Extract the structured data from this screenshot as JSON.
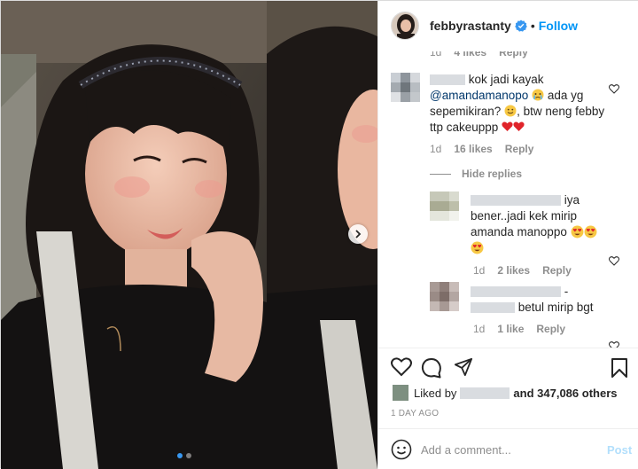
{
  "header": {
    "username": "febbyrastanty",
    "separator": "•",
    "follow_label": "Follow"
  },
  "comments": {
    "partial_meta": {
      "time": "1d",
      "likes": "4 likes",
      "reply": "Reply"
    },
    "main": {
      "text_line1": "kok jadi kayak",
      "mention": "@amandamanopo",
      "text_line2_suffix": "ada yg",
      "text_line3": "sepemikiran?",
      "text_line3_suffix": ", btw neng febby",
      "text_line4": "ttp cakeuppp",
      "time": "1d",
      "likes": "16 likes",
      "reply": "Reply"
    },
    "hide_replies": "Hide replies",
    "reply1": {
      "text_line1": "iya",
      "text_line2": "bener..jadi kek mirip",
      "text_line3": "amanda manoppo",
      "time": "1d",
      "likes": "2 likes",
      "reply": "Reply"
    },
    "reply2": {
      "text_line1": "-",
      "text_line2": "betul mirip bgt",
      "time": "1d",
      "likes": "1 like",
      "reply": "Reply"
    }
  },
  "likes_bar": {
    "prefix": "Liked by",
    "and_text": "and 347,086 others"
  },
  "post_time": "1 DAY AGO",
  "add_comment": {
    "placeholder": "Add a comment...",
    "post_label": "Post"
  },
  "colors": {
    "accent": "#0095f6",
    "heart_red": "#ed1c24",
    "muted": "#8e8e8e"
  }
}
